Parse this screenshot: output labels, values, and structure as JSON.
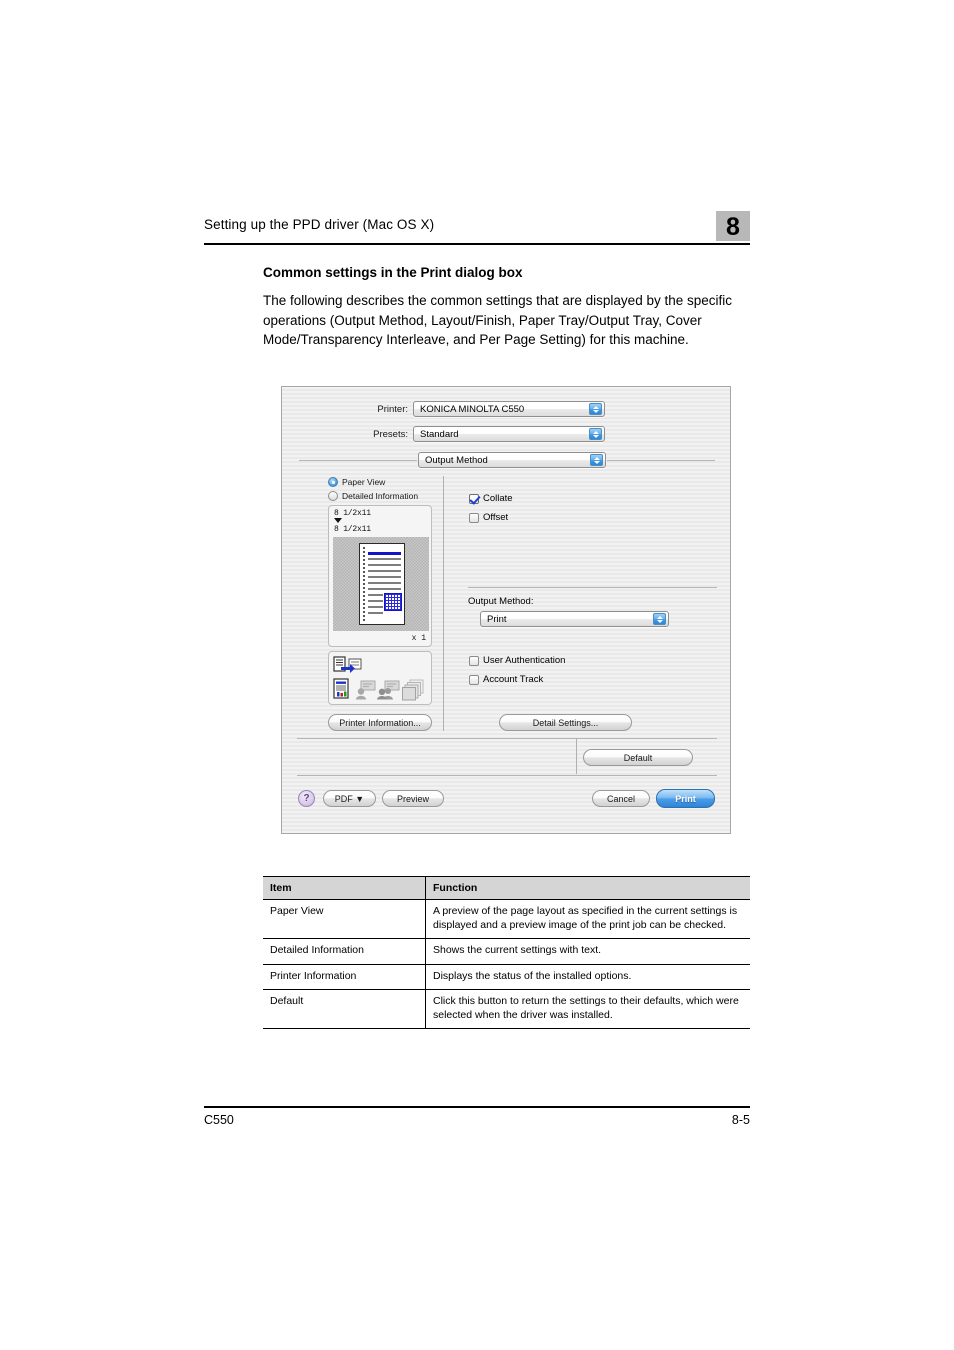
{
  "page": {
    "header_title": "Setting up the PPD driver (Mac OS X)",
    "chapter_number": "8",
    "section_heading": "Common settings in the Print dialog box",
    "body_paragraph": "The following describes the common settings that are displayed by the specific operations (Output Method, Layout/Finish, Paper Tray/Output Tray, Cover Mode/Transparency Interleave, and Per Page Setting) for this machine.",
    "footer_left": "C550",
    "footer_right": "8-5"
  },
  "dialog": {
    "printer_label": "Printer:",
    "printer_value": "KONICA MINOLTA C550",
    "presets_label": "Presets:",
    "presets_value": "Standard",
    "pane_value": "Output Method",
    "view_mode": {
      "paper_view": "Paper View",
      "detailed_information": "Detailed Information"
    },
    "preview": {
      "size_top": "8 1/2x11",
      "size_bottom": "8 1/2x11",
      "copies": "x 1"
    },
    "finishing": {
      "collate": "Collate",
      "collate_checked": true,
      "offset": "Offset",
      "offset_checked": false
    },
    "output_method": {
      "label": "Output Method:",
      "value": "Print"
    },
    "auth": {
      "user_authentication": "User Authentication",
      "user_authentication_checked": false,
      "account_track": "Account Track",
      "account_track_checked": false
    },
    "buttons": {
      "printer_information": "Printer Information...",
      "detail_settings": "Detail Settings...",
      "default": "Default",
      "help": "?",
      "pdf": "PDF ▼",
      "preview": "Preview",
      "cancel": "Cancel",
      "print": "Print"
    }
  },
  "table": {
    "headers": [
      "Item",
      "Function"
    ],
    "rows": [
      {
        "item": "Paper View",
        "function": "A preview of the page layout as specified in the current settings is displayed and a preview image of the print job can be checked."
      },
      {
        "item": "Detailed Information",
        "function": "Shows the current settings with text."
      },
      {
        "item": "Printer Information",
        "function": "Displays the status of the installed options."
      },
      {
        "item": "Default",
        "function": "Click this button to return the settings to their defaults, which were selected when the driver was installed."
      }
    ]
  },
  "colors": {
    "accent_blue": "#2d84d8",
    "badge_gray": "#b8b8b8",
    "table_header_gray": "#d5d5d5"
  }
}
